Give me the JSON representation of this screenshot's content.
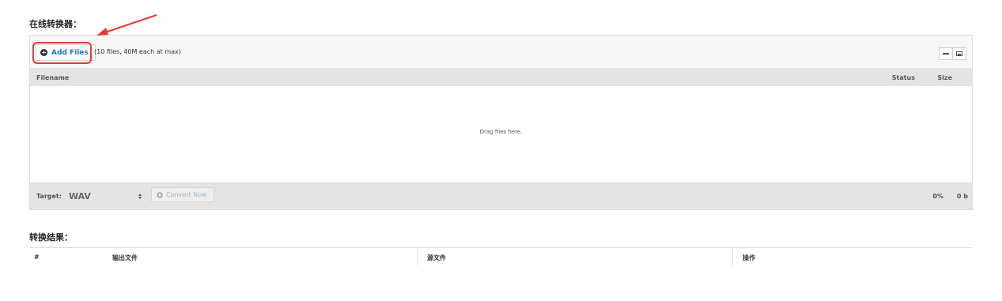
{
  "page": {
    "converter_title": "在线转换器：",
    "results_title": "转换结果："
  },
  "uploader": {
    "add_files_label": "Add Files",
    "limit_text": "(10 files, 40M each at max)",
    "columns": {
      "filename": "Filename",
      "status": "Status",
      "size": "Size"
    },
    "drop_text": "Drag files here.",
    "footer": {
      "target_label": "Target:",
      "target_value": "WAV",
      "convert_label": "Convert Now",
      "progress": "0%",
      "total_size": "0 b"
    },
    "view_icons": [
      "list-icon",
      "thumbnail-icon"
    ]
  },
  "results": {
    "headers": [
      "#",
      "输出文件",
      "源文件",
      "操作"
    ]
  },
  "colors": {
    "accent_blue": "#1a73c8",
    "annotation_red": "#e83a2f",
    "bar_gray": "#e4e4e4"
  }
}
